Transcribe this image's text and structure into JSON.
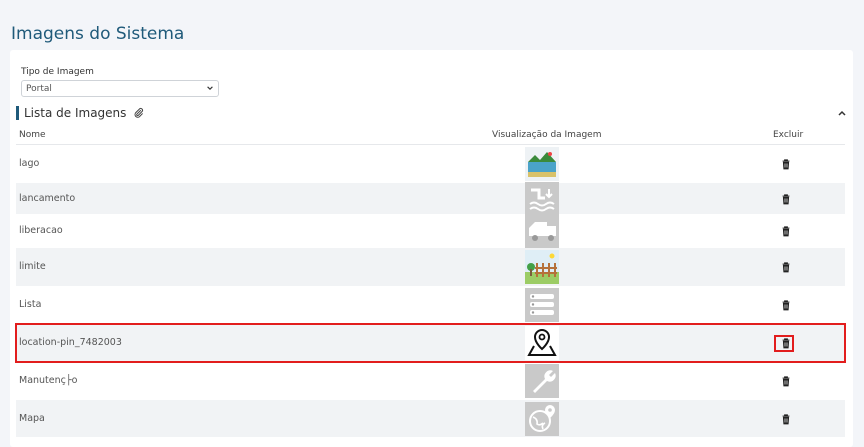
{
  "page": {
    "title": "Imagens do Sistema"
  },
  "filter": {
    "label": "Tipo de Imagem",
    "selected": "Portal"
  },
  "section": {
    "title": "Lista de Imagens"
  },
  "table": {
    "headers": {
      "name": "Nome",
      "preview": "Visualização da Imagem",
      "delete": "Excluir"
    },
    "rows": [
      {
        "name": "lago",
        "icon": "lake-landscape-icon",
        "colored": true
      },
      {
        "name": "lancamento",
        "icon": "discharge-icon",
        "colored": false
      },
      {
        "name": "liberacao",
        "icon": "truck-icon",
        "colored": false
      },
      {
        "name": "limite",
        "icon": "fence-landscape-icon",
        "colored": true
      },
      {
        "name": "Lista",
        "icon": "list-icon",
        "colored": false
      },
      {
        "name": "location-pin_7482003",
        "icon": "location-pin-map-icon",
        "colored": false,
        "selected": true
      },
      {
        "name": "Manutenç├o",
        "icon": "wrench-icon",
        "colored": false
      },
      {
        "name": "Mapa",
        "icon": "globe-pin-icon",
        "colored": false
      }
    ]
  },
  "colors": {
    "accent": "#1f5a7a",
    "highlight": "#e21d1d"
  }
}
